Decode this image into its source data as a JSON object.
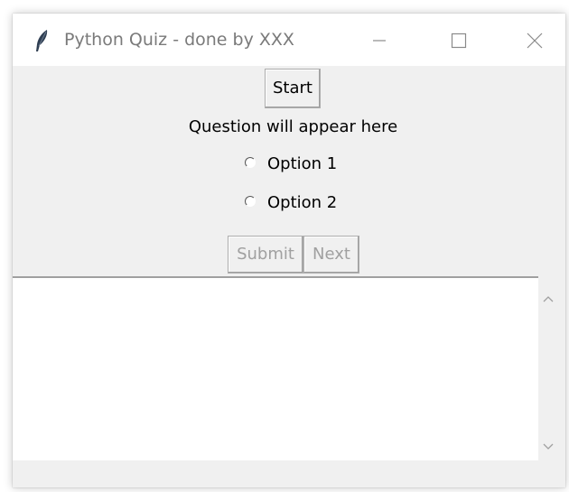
{
  "window": {
    "title": "Python Quiz - done by XXX"
  },
  "controls": {
    "start_label": "Start",
    "question_text": "Question will appear here",
    "options": [
      {
        "label": "Option 1",
        "selected": false
      },
      {
        "label": "Option 2",
        "selected": false
      }
    ],
    "submit_label": "Submit",
    "submit_enabled": false,
    "next_label": "Next",
    "next_enabled": false
  },
  "output": {
    "text": ""
  },
  "icons": {
    "app": "feather-icon",
    "minimize": "minimize-icon",
    "maximize": "maximize-icon",
    "close": "close-icon",
    "scroll_up": "chevron-up-icon",
    "scroll_down": "chevron-down-icon"
  }
}
